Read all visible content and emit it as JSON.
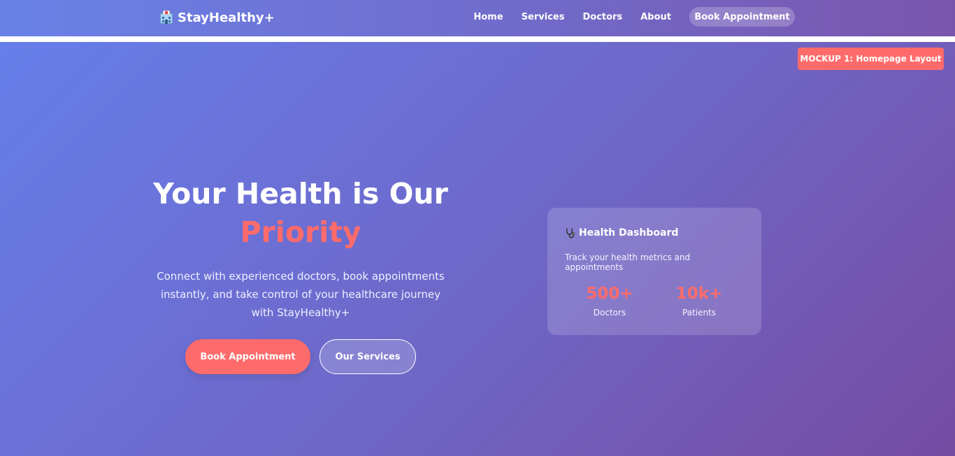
{
  "nav": {
    "brand": "StayHealthy+",
    "brand_icon": "hospital-icon",
    "links": [
      "Home",
      "Services",
      "Doctors",
      "About"
    ],
    "cta": "Book Appointment"
  },
  "hero": {
    "tag": "MOCKUP 1: Homepage Layout",
    "title_line1": "Your Health is Our",
    "title_accent": "Priority",
    "description": "Connect with experienced doctors, book appointments instantly, and take control of your healthcare journey with StayHealthy+",
    "primary_button": "Book Appointment",
    "secondary_button": "Our Services"
  },
  "dashboard": {
    "icon": "stethoscope-icon",
    "title": "Health Dashboard",
    "subtitle": "Track your health metrics and appointments",
    "stats": [
      {
        "value": "500+",
        "label": "Doctors"
      },
      {
        "value": "10k+",
        "label": "Patients"
      }
    ]
  },
  "colors": {
    "accent": "#ff6b6b",
    "gradient_start": "#667eea",
    "gradient_end": "#764ba2"
  }
}
